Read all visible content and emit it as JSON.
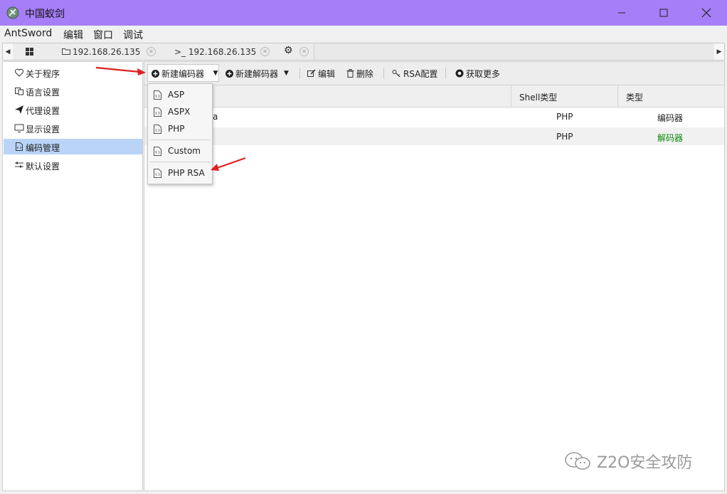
{
  "window": {
    "title": "中国蚁剑"
  },
  "menubar": [
    "AntSword",
    "编辑",
    "窗口",
    "调试"
  ],
  "tabs": [
    {
      "label": "192.168.26.135"
    },
    {
      "label": ">_ 192.168.26.135"
    }
  ],
  "sidebar": {
    "items": [
      {
        "label": "关于程序",
        "icon": "heart-icon"
      },
      {
        "label": "语言设置",
        "icon": "language-icon"
      },
      {
        "label": "代理设置",
        "icon": "send-icon"
      },
      {
        "label": "显示设置",
        "icon": "monitor-icon"
      },
      {
        "label": "编码管理",
        "icon": "file-code-icon",
        "active": true
      },
      {
        "label": "默认设置",
        "icon": "sliders-icon"
      }
    ]
  },
  "toolbar": {
    "new_encoder": "新建编码器",
    "new_decoder": "新建解码器",
    "edit": "编辑",
    "delete": "删除",
    "rsa": "RSA配置",
    "more": "获取更多"
  },
  "dropdown": {
    "items": [
      "ASP",
      "ASPX",
      "PHP",
      "Custom",
      "PHP RSA"
    ]
  },
  "table": {
    "columns": [
      "Shell类型",
      "类型"
    ],
    "rows": [
      {
        "name_fragment": "a",
        "shell": "PHP",
        "type": "编码器",
        "type_color": "#111111"
      },
      {
        "name_fragment": "",
        "shell": "PHP",
        "type": "解码器",
        "type_color": "#0a8a0a"
      }
    ]
  },
  "watermark": {
    "text": "Z2O安全攻防"
  },
  "colors": {
    "titlebar": "#a67ef7",
    "selection": "#b9d4f7",
    "arrow": "#e02020"
  }
}
